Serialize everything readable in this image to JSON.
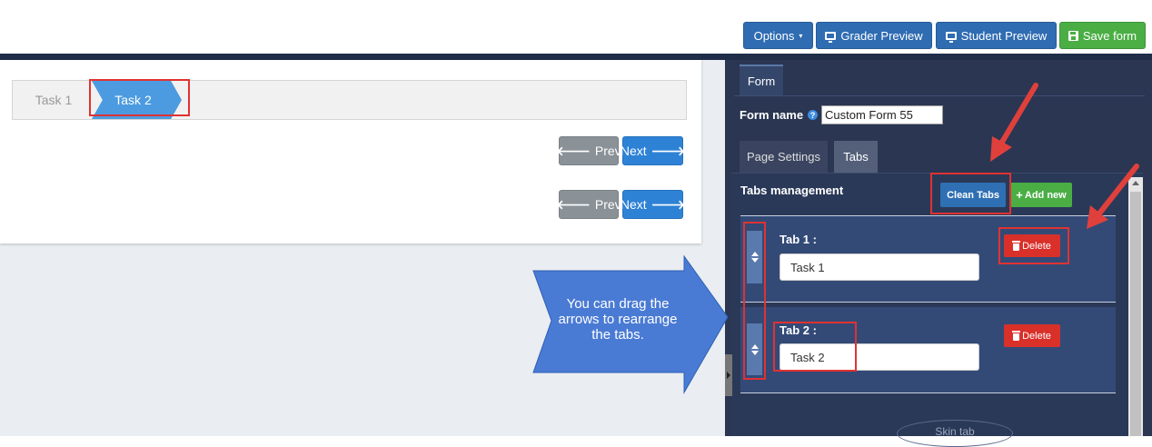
{
  "toolbar": {
    "options_label": "Options",
    "grader_preview_label": "Grader Preview",
    "student_preview_label": "Student Preview",
    "save_form_label": "Save form"
  },
  "preview": {
    "tabs": [
      {
        "label": "Task 1",
        "active": false
      },
      {
        "label": "Task 2",
        "active": true
      }
    ],
    "nav": [
      {
        "prev_label": "Prev",
        "next_label": "Next"
      },
      {
        "prev_label": "Prev",
        "next_label": "Next"
      }
    ]
  },
  "callout": {
    "text": "You can drag the arrows to rearrange the tabs."
  },
  "panel": {
    "main_tab": "Form",
    "form_name_label": "Form name",
    "form_name_value": "Custom Form 55",
    "subtabs": [
      "Page Settings",
      "Tabs"
    ],
    "tabs_management_label": "Tabs management",
    "clean_tabs_label": "Clean Tabs",
    "add_new_label": "Add new",
    "tab_entries": [
      {
        "label": "Tab 1 :",
        "value": "Task 1",
        "delete_label": "Delete"
      },
      {
        "label": "Tab 2 :",
        "value": "Task 2",
        "delete_label": "Delete"
      }
    ],
    "skin_tab_label": "Skin tab"
  },
  "colors": {
    "toolbar_blue": "#2f6cb2",
    "save_green": "#4aae45",
    "panel_bg": "#2a3652",
    "active_task_tab": "#4c9be0",
    "delete_red": "#d9302a",
    "annotation_red": "#e03232",
    "callout_blue": "#4a7bd4"
  }
}
